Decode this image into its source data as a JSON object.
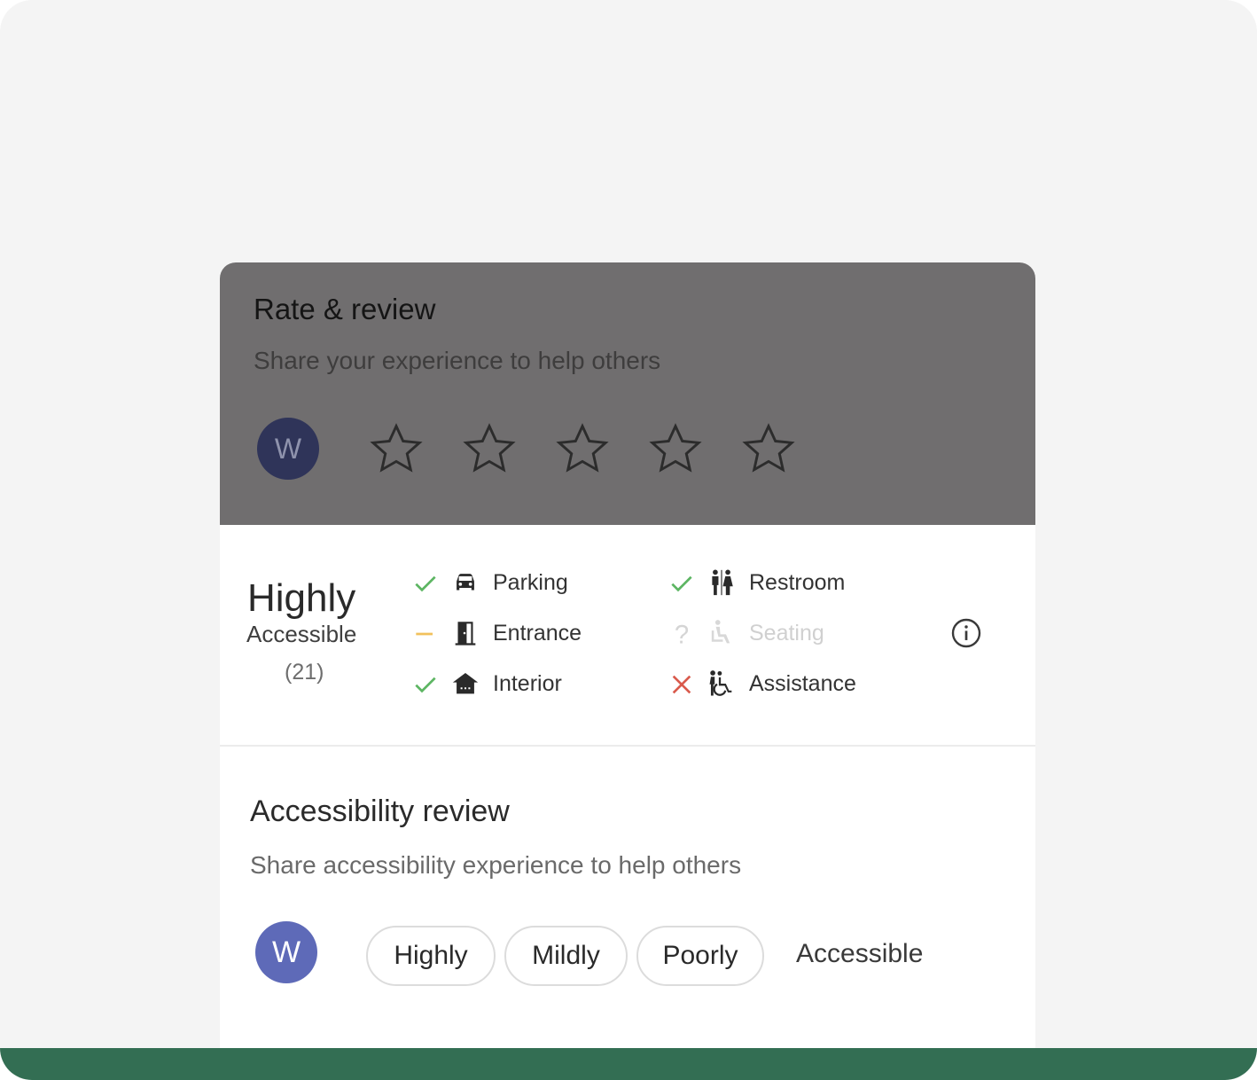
{
  "rate_review": {
    "title": "Rate & review",
    "subtitle": "Share your experience to help others",
    "avatar_initial": "W",
    "stars": [
      {
        "name": "star-1"
      },
      {
        "name": "star-2"
      },
      {
        "name": "star-3"
      },
      {
        "name": "star-4"
      },
      {
        "name": "star-5"
      }
    ]
  },
  "summary": {
    "level": "Highly",
    "level_sub": "Accessible",
    "count": "(21)",
    "features": [
      {
        "label": "Parking",
        "status": "yes",
        "icon": "car-icon"
      },
      {
        "label": "Entrance",
        "status": "partial",
        "icon": "door-icon"
      },
      {
        "label": "Interior",
        "status": "yes",
        "icon": "house-icon"
      },
      {
        "label": "Restroom",
        "status": "yes",
        "icon": "restroom-icon"
      },
      {
        "label": "Seating",
        "status": "unknown",
        "icon": "seated-person-icon"
      },
      {
        "label": "Assistance",
        "status": "no",
        "icon": "wheelchair-icon"
      }
    ]
  },
  "accessibility_review": {
    "title": "Accessibility review",
    "subtitle": "Share accessibility experience to help others",
    "avatar_initial": "W",
    "chips": [
      "Highly",
      "Mildly",
      "Poorly"
    ],
    "trailing": "Accessible"
  },
  "colors": {
    "check": "#5cb562",
    "partial": "#f1c15c",
    "cross": "#d95a4c",
    "avatar": "#5e6ab8",
    "footer": "#336e53"
  }
}
